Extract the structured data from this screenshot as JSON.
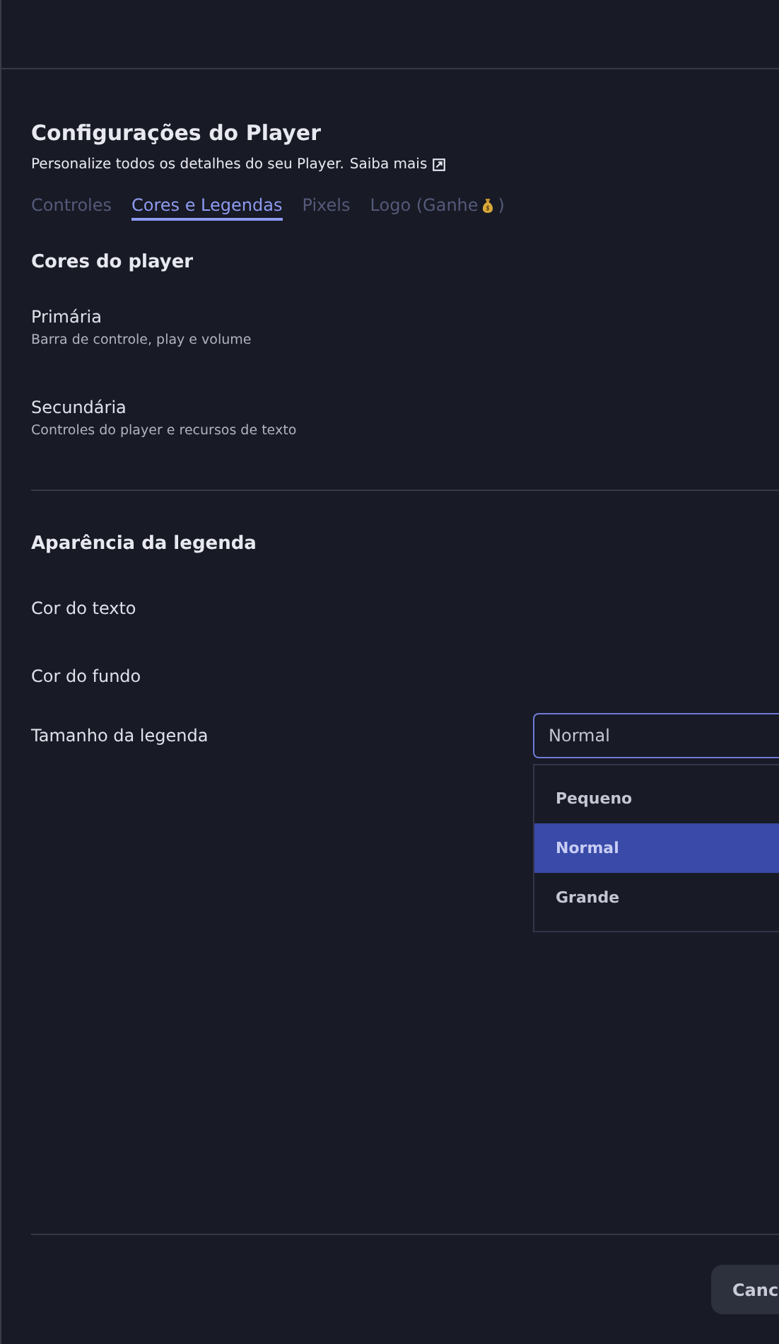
{
  "title": "Configurações do Player",
  "subtitle": "Personalize todos os detalhes do seu Player.",
  "learn_more": "Saiba mais",
  "tabs": [
    {
      "label": "Controles",
      "selected": false
    },
    {
      "label": "Cores e Legendas",
      "selected": true
    },
    {
      "label": "Pixels",
      "selected": false
    },
    {
      "label": "Logo (Ganhe",
      "label_after": ")",
      "selected": false
    }
  ],
  "player_colors": {
    "heading": "Cores do player",
    "items": [
      {
        "label": "Primária",
        "description": "Barra de controle, play e volume"
      },
      {
        "label": "Secundária",
        "description": "Controles do player e recursos de texto"
      }
    ]
  },
  "caption": {
    "heading": "Aparência da legenda",
    "rows": [
      {
        "label": "Cor do texto"
      },
      {
        "label": "Cor do fundo"
      }
    ],
    "size": {
      "label": "Tamanho da legenda",
      "value": "Normal",
      "options": [
        {
          "label": "Pequeno",
          "selected": false
        },
        {
          "label": "Normal",
          "selected": true
        },
        {
          "label": "Grande",
          "selected": false
        }
      ]
    }
  },
  "footer": {
    "cancel": "Canc"
  }
}
